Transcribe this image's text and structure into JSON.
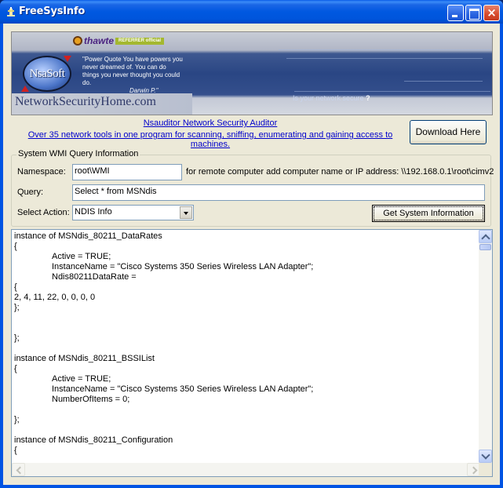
{
  "window": {
    "title": "FreeSysInfo",
    "icon": "app-icon"
  },
  "banner": {
    "certificate_brand": "thawte",
    "certificate_badge": "REFERRER official",
    "logo_text": "NsaSoft",
    "quote": "\"Power Quote You have powers you never dreamed of. You can do things you never thought you could do.",
    "quote_author": "Darwin P.\"",
    "site_name": "NetworkSecurityHome.com",
    "tagline": "Is your network secure",
    "tagline_mark": "?"
  },
  "promo": {
    "title_link": "Nsauditor Network Security Auditor",
    "desc_link": "Over 35 network tools in one program for scanning, sniffing, enumerating and gaining access to machines.",
    "download_button": "Download Here"
  },
  "query_group": {
    "title": "System WMI Query Information",
    "namespace_label": "Namespace:",
    "namespace_value": "root\\WMI",
    "namespace_hint": "for remote computer add computer name or IP address: \\\\192.168.0.1\\root\\cimv2",
    "query_label": "Query:",
    "query_value": "Select * from MSNdis",
    "action_label": "Select Action:",
    "action_value": "NDIS Info",
    "get_info_button": "Get System Information"
  },
  "output": {
    "lines": [
      "instance of MSNdis_80211_DataRates",
      "{",
      "\tActive = TRUE;",
      "\tInstanceName = \"Cisco Systems 350 Series Wireless LAN Adapter\";",
      "\tNdis80211DataRate = ",
      "{",
      "2, 4, 11, 22, 0, 0, 0, 0",
      "};",
      "",
      "",
      "};",
      "",
      "instance of MSNdis_80211_BSSIList",
      "{",
      "\tActive = TRUE;",
      "\tInstanceName = \"Cisco Systems 350 Series Wireless LAN Adapter\";",
      "\tNumberOfItems = 0;",
      "",
      "};",
      "",
      "instance of MSNdis_80211_Configuration",
      "{"
    ]
  }
}
